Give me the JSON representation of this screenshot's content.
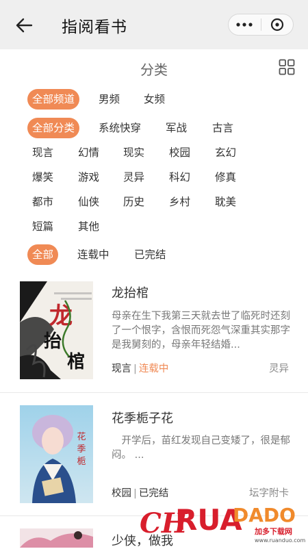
{
  "header": {
    "title": "指阅看书"
  },
  "category_title": "分类",
  "filters": {
    "channel": [
      {
        "label": "全部频道",
        "active": true
      },
      {
        "label": "男频",
        "active": false
      },
      {
        "label": "女频",
        "active": false
      }
    ],
    "genre_row1": [
      {
        "label": "全部分类",
        "active": true
      },
      {
        "label": "系统快穿",
        "active": false
      },
      {
        "label": "军战",
        "active": false
      },
      {
        "label": "古言",
        "active": false
      }
    ],
    "genre_row2": [
      "现言",
      "幻情",
      "现实",
      "校园",
      "玄幻"
    ],
    "genre_row3": [
      "爆笑",
      "游戏",
      "灵异",
      "科幻",
      "修真"
    ],
    "genre_row4": [
      "都市",
      "仙侠",
      "历史",
      "乡村",
      "耽美"
    ],
    "genre_row5": [
      "短篇",
      "其他"
    ],
    "status": [
      {
        "label": "全部",
        "active": true
      },
      {
        "label": "连载中",
        "active": false
      },
      {
        "label": "已完结",
        "active": false
      }
    ]
  },
  "books": [
    {
      "title": "龙抬棺",
      "desc": "母亲在生下我第三天就去世了临死时还刻了一个恨字，含恨而死怨气深重其实那字是我舅刻的，母亲年轻结婚...",
      "category": "现言",
      "status": "连载中",
      "tag": "灵异",
      "cover_text": "龙抬棺"
    },
    {
      "title": "花季栀子花",
      "desc": "　开学后，苗红发现自己变矮了，很是郁闷。 ...",
      "category": "校园",
      "status": "已完结",
      "tag": "坛字附卡"
    },
    {
      "title": "少侠，做我"
    }
  ],
  "watermark": {
    "brand": "RUANDUO",
    "sub": "加多下载网",
    "url": "www.ruanduo.com"
  },
  "colors": {
    "accent": "#f08a55",
    "topbar": "#efefef"
  }
}
